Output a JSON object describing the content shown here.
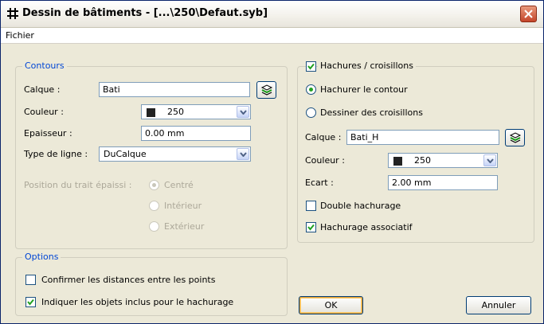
{
  "window": {
    "title": "Dessin de bâtiments - [...\\250\\Defaut.syb]"
  },
  "menu": {
    "items": [
      "Fichier"
    ]
  },
  "contours": {
    "legend": "Contours",
    "calque_label": "Calque :",
    "calque_value": "Bati",
    "couleur_label": "Couleur :",
    "couleur_value": "250",
    "epaisseur_label": "Epaisseur :",
    "epaisseur_value": "0.00 mm",
    "type_ligne_label": "Type de ligne :",
    "type_ligne_value": "DuCalque",
    "position_label": "Position du trait épaissi :",
    "position_options": [
      "Centré",
      "Intérieur",
      "Extérieur"
    ]
  },
  "options": {
    "legend": "Options",
    "confirm_label": "Confirmer les distances entre les points",
    "confirm_checked": false,
    "indiquer_label": "Indiquer les objets inclus pour le hachurage",
    "indiquer_checked": true
  },
  "hachures": {
    "legend": "Hachures / croisillons",
    "enabled": true,
    "radio_hachurer": "Hachurer le contour",
    "radio_croisillons": "Dessiner des croisillons",
    "selected_radio": "Hachurer le contour",
    "calque_label": "Calque :",
    "calque_value": "Bati_H",
    "couleur_label": "Couleur :",
    "couleur_value": "250",
    "ecart_label": "Ecart :",
    "ecart_value": "2.00 mm",
    "double_label": "Double hachurage",
    "double_checked": false,
    "associatif_label": "Hachurage associatif",
    "associatif_checked": true
  },
  "buttons": {
    "ok": "OK",
    "cancel": "Annuler"
  },
  "colors": {
    "legend_text": "#0046d5",
    "dialog_bg": "#ece9d8",
    "swatch": "#222222"
  }
}
